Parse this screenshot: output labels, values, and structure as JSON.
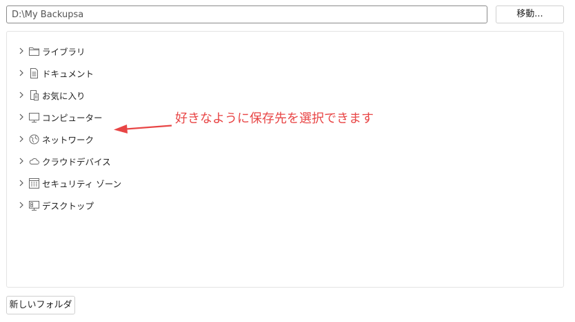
{
  "path_bar": {
    "value": "D:\\My Backupsa"
  },
  "move_button": {
    "label": "移動..."
  },
  "tree": {
    "items": [
      {
        "label": "ライブラリ",
        "icon": "folder-icon"
      },
      {
        "label": "ドキュメント",
        "icon": "document-icon"
      },
      {
        "label": "お気に入り",
        "icon": "favorites-icon"
      },
      {
        "label": "コンピューター",
        "icon": "computer-icon"
      },
      {
        "label": "ネットワーク",
        "icon": "network-globe-icon"
      },
      {
        "label": "クラウドデバイス",
        "icon": "cloud-icon"
      },
      {
        "label": "セキュリティ ゾーン",
        "icon": "security-zone-icon"
      },
      {
        "label": "デスクトップ",
        "icon": "desktop-icon"
      }
    ]
  },
  "annotation": {
    "text": "好きなように保存先を選択できます",
    "color": "#e84545"
  },
  "new_folder_button": {
    "label": "新しいフォルダ"
  },
  "colors": {
    "border": "#8a8a8a",
    "panel_border": "#e3e3e3",
    "annotation": "#e84545"
  }
}
